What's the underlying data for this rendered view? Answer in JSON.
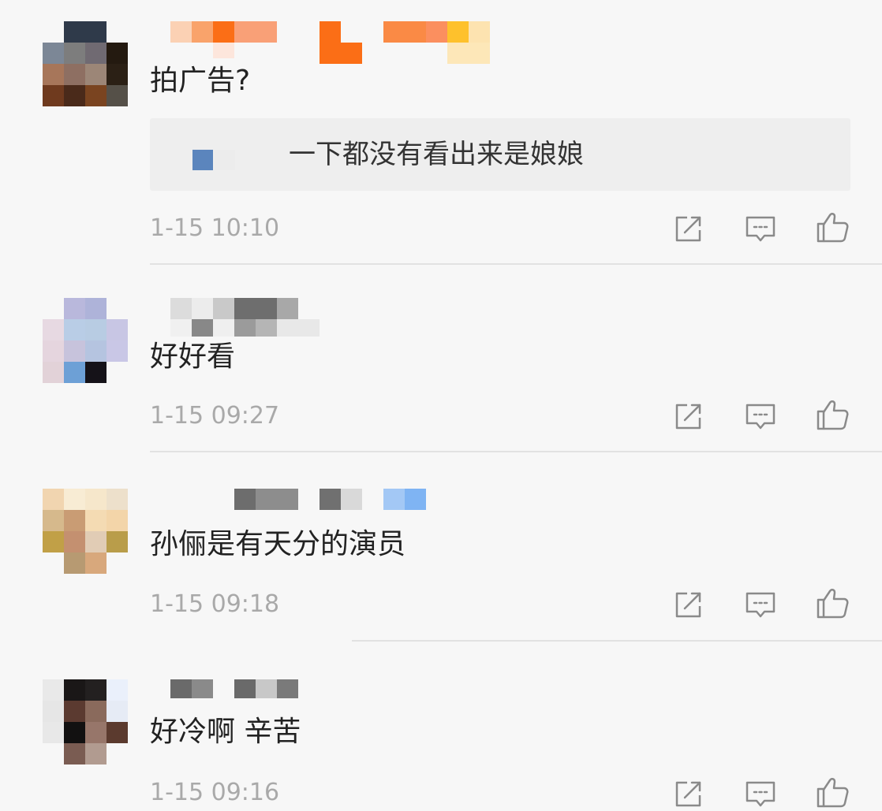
{
  "comments": [
    {
      "text": "拍广告?",
      "quote": {
        "text": "一下都没有看出来是娘娘"
      },
      "time": "1-15 10:10"
    },
    {
      "text": "好好看",
      "time": "1-15 09:27"
    },
    {
      "text": "孙俪是有天分的演员",
      "time": "1-15 09:18"
    },
    {
      "text": "好冷啊 辛苦",
      "time": "1-15 09:16"
    }
  ],
  "icons": {
    "share": "share-icon",
    "reply": "comment-icon",
    "like": "thumbs-up-icon"
  },
  "colors": {
    "text": "#222222",
    "meta": "#a9a9a9",
    "icon": "#8a8a8a",
    "quote_bg": "#eeeeee"
  }
}
